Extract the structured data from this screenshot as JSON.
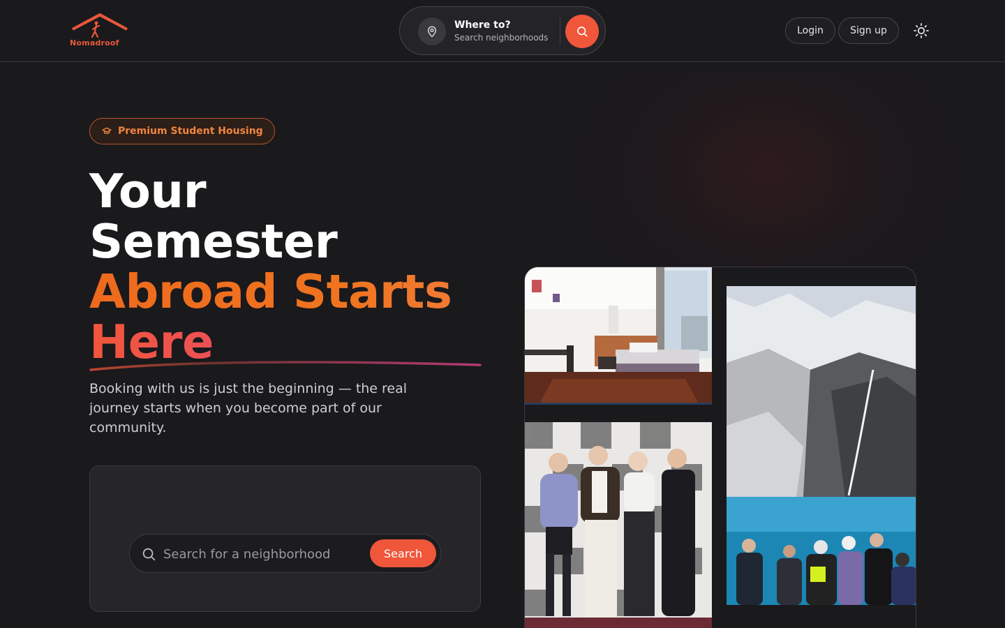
{
  "header": {
    "logo_text": "Nomadroof",
    "search": {
      "title": "Where to?",
      "subtitle": "Search neighborhoods"
    },
    "login_label": "Login",
    "signup_label": "Sign up"
  },
  "hero": {
    "badge_label": "Premium Student Housing",
    "headline": {
      "line1": "Your",
      "line2": "Semester",
      "line3": "Abroad Starts",
      "line4": "Here"
    },
    "subtext": "Booking with us is just the beginning — the real journey starts when you become part of our community.",
    "search": {
      "placeholder": "Search for a neighborhood",
      "button_label": "Search"
    }
  },
  "gallery": {
    "images": [
      "student-room-photo",
      "group-photo",
      "mountain-waterfall-photo",
      "lake-tourists-photo"
    ]
  },
  "colors": {
    "accent": "#f0563a",
    "orange": "#f0741f",
    "pink": "#e2468e",
    "background": "#1a191c"
  },
  "icons": [
    "map-pin-icon",
    "search-icon",
    "sun-icon",
    "graduation-cap-icon"
  ]
}
